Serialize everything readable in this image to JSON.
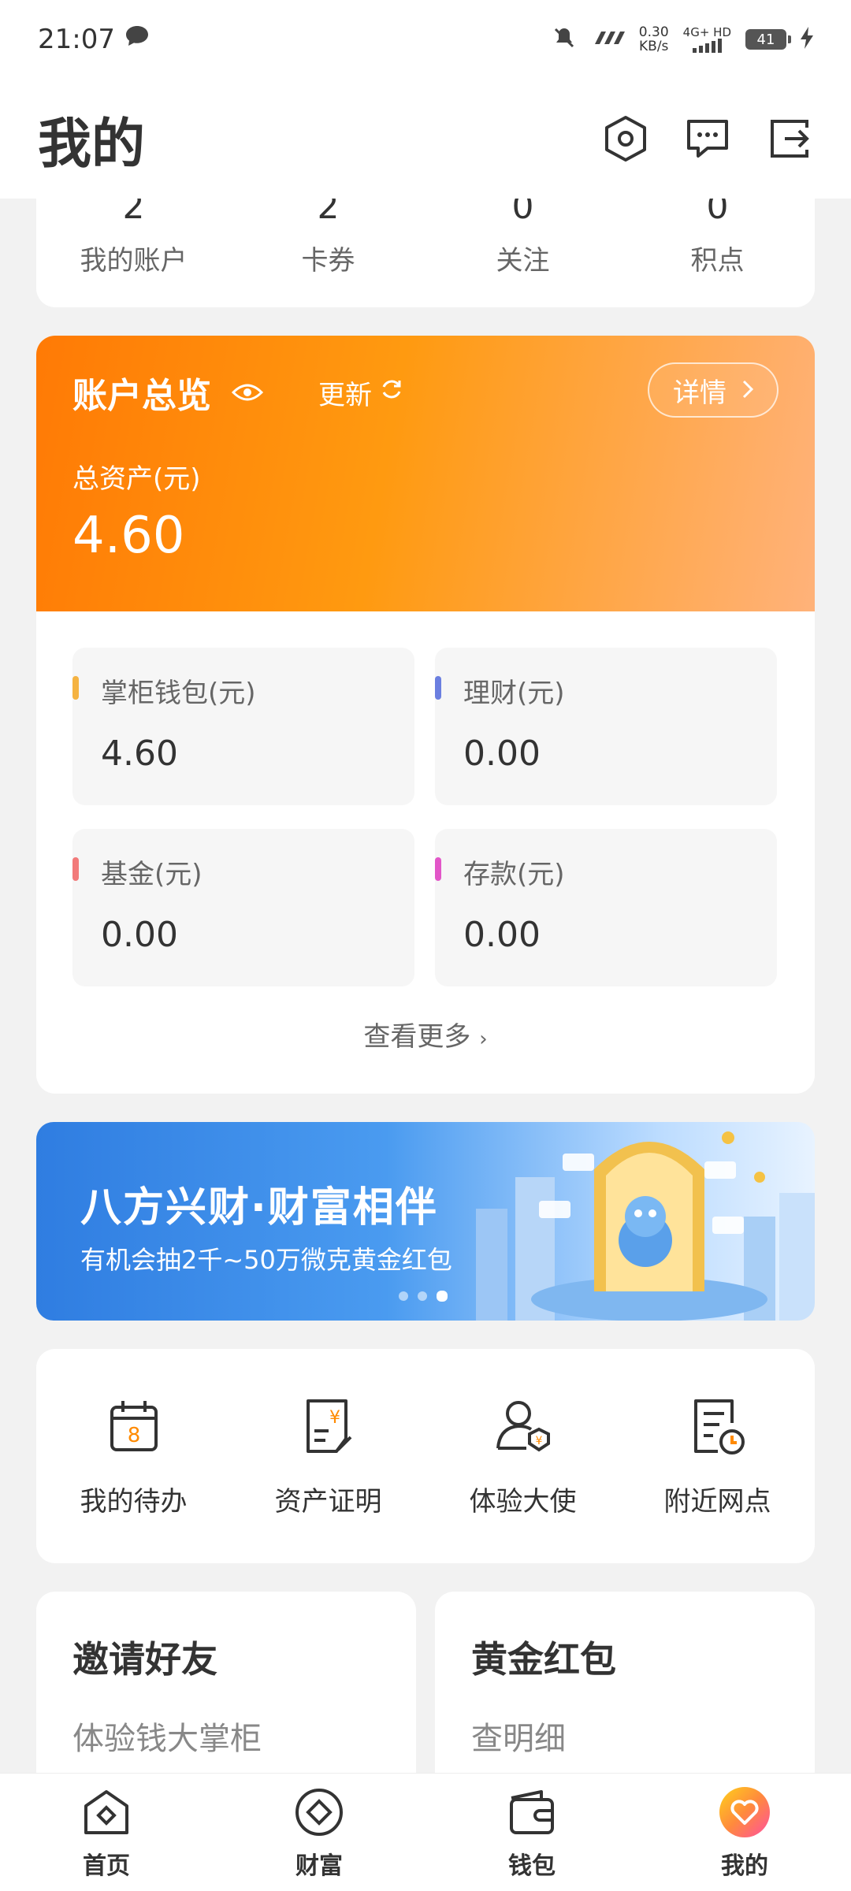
{
  "status_bar": {
    "time": "21:07",
    "net_speed_value": "0.30",
    "net_speed_unit": "KB/s",
    "network": "4G+ HD",
    "battery": "41"
  },
  "header": {
    "title": "我的",
    "icons": [
      "settings-hexagon-icon",
      "message-icon",
      "logout-icon"
    ]
  },
  "stats": [
    {
      "value": "2",
      "label": "我的账户"
    },
    {
      "value": "2",
      "label": "卡券"
    },
    {
      "value": "0",
      "label": "关注"
    },
    {
      "value": "0",
      "label": "积点"
    }
  ],
  "overview": {
    "title": "账户总览",
    "update_label": "更新",
    "detail_label": "详情",
    "total_label": "总资产(元)",
    "total_value": "4.60",
    "items": [
      {
        "name": "掌柜钱包(元)",
        "amount": "4.60",
        "color": "#f5b342"
      },
      {
        "name": "理财(元)",
        "amount": "0.00",
        "color": "#6b7fe0"
      },
      {
        "name": "基金(元)",
        "amount": "0.00",
        "color": "#f27a7a"
      },
      {
        "name": "存款(元)",
        "amount": "0.00",
        "color": "#e256c8"
      }
    ],
    "see_more": "查看更多"
  },
  "banner": {
    "title": "八方兴财·财富相伴",
    "subtitle": "有机会抽2千~50万微克黄金红包"
  },
  "services": [
    {
      "label": "我的待办",
      "icon": "calendar-icon"
    },
    {
      "label": "资产证明",
      "icon": "asset-certificate-icon"
    },
    {
      "label": "体验大使",
      "icon": "ambassador-icon"
    },
    {
      "label": "附近网点",
      "icon": "nearby-branch-icon"
    }
  ],
  "promos": [
    {
      "title": "邀请好友",
      "subtitle": "体验钱大掌柜"
    },
    {
      "title": "黄金红包",
      "subtitle": "查明细"
    }
  ],
  "bottom_nav": [
    {
      "label": "首页",
      "icon": "home-icon"
    },
    {
      "label": "财富",
      "icon": "wealth-icon"
    },
    {
      "label": "钱包",
      "icon": "wallet-icon"
    },
    {
      "label": "我的",
      "icon": "profile-heart-icon"
    }
  ],
  "colors": {
    "accent_orange": "#ff8a00",
    "active_nav": "#ff9f1a"
  }
}
